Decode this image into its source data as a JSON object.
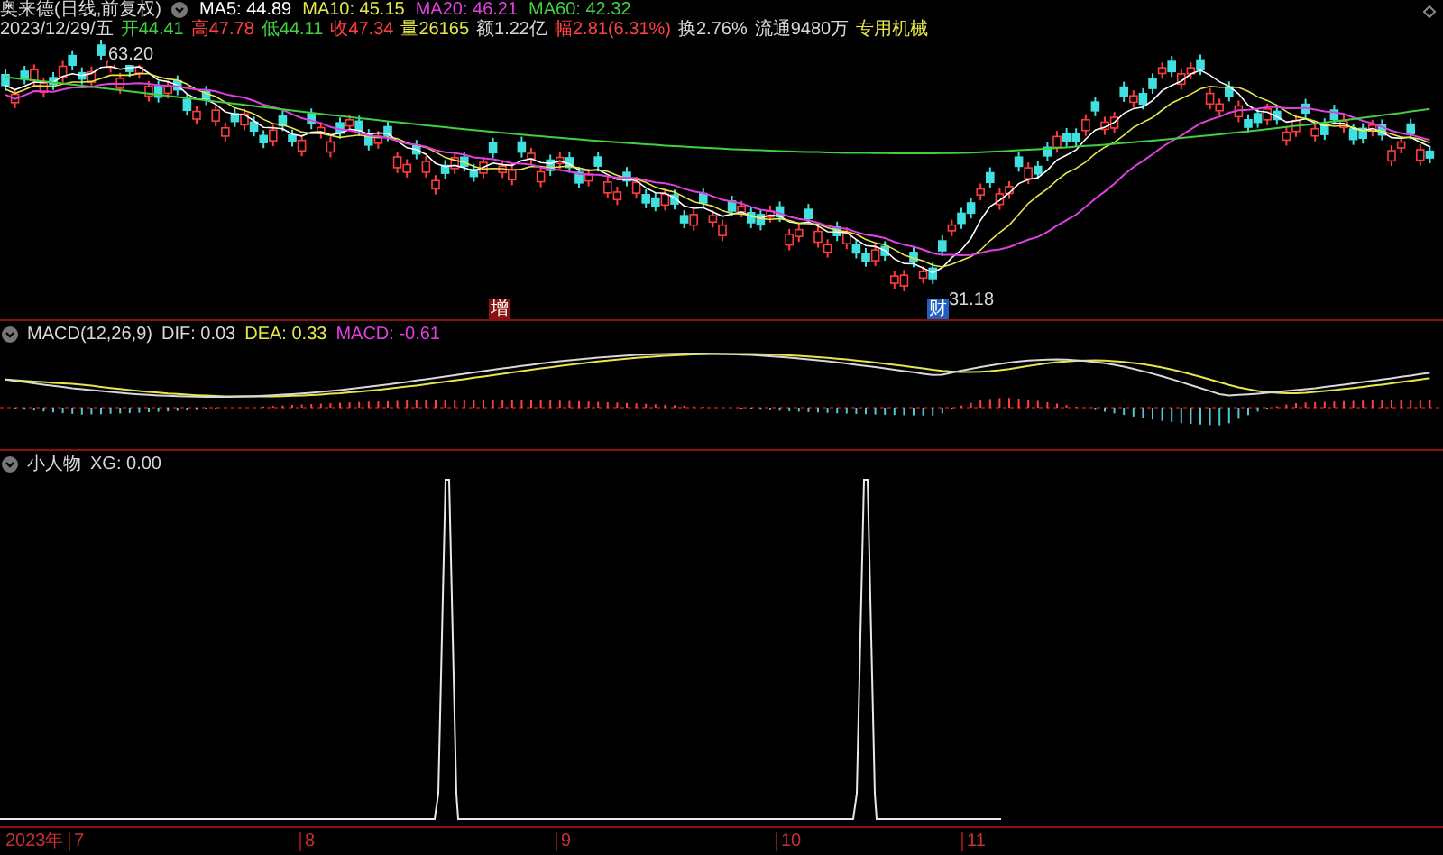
{
  "header": {
    "stock_title": "奥来德(日线,前复权)",
    "moving_averages": [
      {
        "label": "MA5: 44.89",
        "color": "#ffffff"
      },
      {
        "label": "MA10: 45.15",
        "color": "#e6e64c"
      },
      {
        "label": "MA20: 46.21",
        "color": "#e040e0"
      },
      {
        "label": "MA60: 42.32",
        "color": "#40d040"
      }
    ]
  },
  "quote": [
    {
      "text": "2023/12/29/五",
      "color": "#d8d8d8"
    },
    {
      "text": "开44.41",
      "color": "#40d040"
    },
    {
      "text": "高47.78",
      "color": "#ff4040"
    },
    {
      "text": "低44.11",
      "color": "#40d040"
    },
    {
      "text": "收47.34",
      "color": "#ff4040"
    },
    {
      "text": "量26165",
      "color": "#e6e64c"
    },
    {
      "text": "额1.22亿",
      "color": "#d8d8d8"
    },
    {
      "text": "幅2.81(6.31%)",
      "color": "#ff4040"
    },
    {
      "text": "换2.76%",
      "color": "#d8d8d8"
    },
    {
      "text": "流通9480万",
      "color": "#d8d8d8"
    },
    {
      "text": "专用机械",
      "color": "#e6e64c"
    }
  ],
  "price_chart": {
    "high_label": "63.20",
    "low_label": "31.18",
    "markers": [
      {
        "text": "增",
        "kind": "increase"
      },
      {
        "text": "财",
        "kind": "finance"
      }
    ]
  },
  "macd_panel": {
    "title": "MACD(12,26,9)",
    "values": [
      {
        "text": "DIF: 0.03",
        "color": "#d8d8d8"
      },
      {
        "text": "DEA: 0.33",
        "color": "#e6e64c"
      },
      {
        "text": "MACD: -0.61",
        "color": "#e040e0"
      }
    ]
  },
  "signal_panel": {
    "title": "小人物",
    "value": "XG: 0.00"
  },
  "time_axis": [
    "2023年",
    "7",
    "8",
    "9",
    "10",
    "11"
  ]
}
